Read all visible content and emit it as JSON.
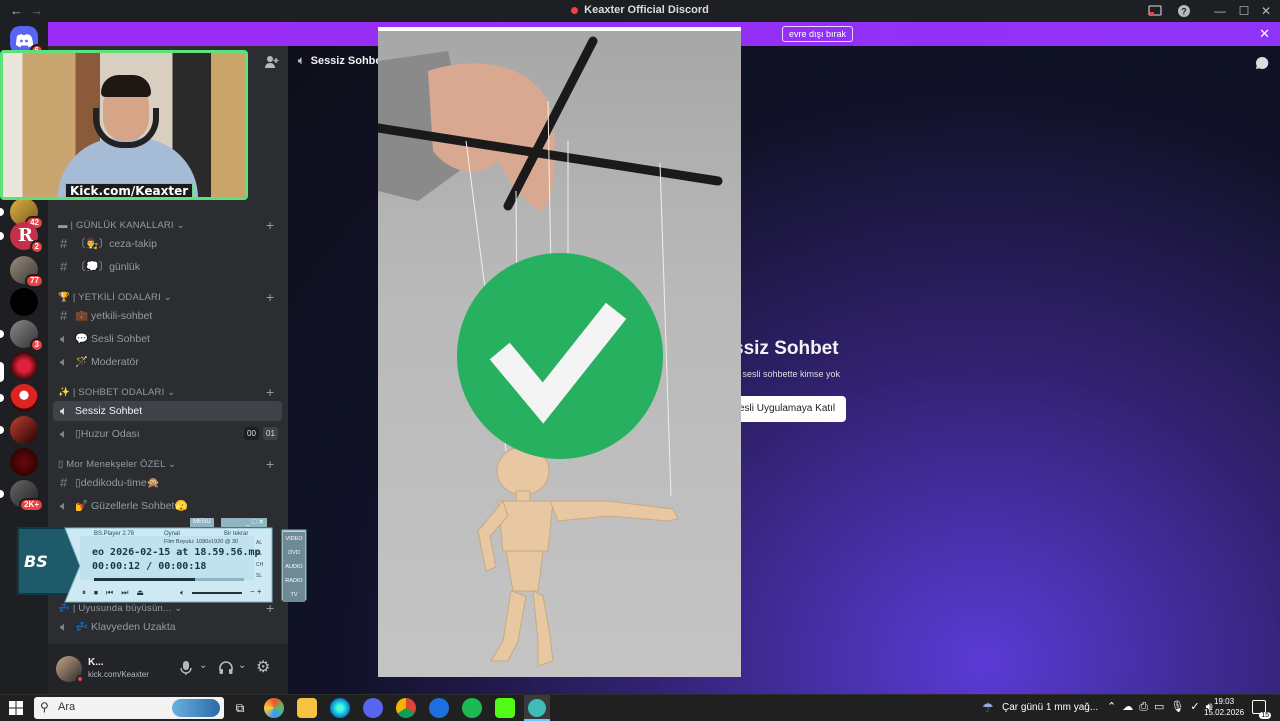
{
  "titlebar": {
    "title": "Keaxter Official Discord",
    "back": "←",
    "forward": "→"
  },
  "notice": {
    "button_label": "evre dışı bırak",
    "close": "✕"
  },
  "rail": {
    "servers": [
      {
        "badge": "6"
      },
      {
        "badge": "42"
      },
      {
        "badge": "2"
      },
      {
        "badge": "77"
      },
      {
        "badge": ""
      },
      {
        "badge": "3"
      },
      {
        "badge": ""
      },
      {
        "badge": ""
      },
      {
        "badge": ""
      },
      {
        "badge": ""
      },
      {
        "badge": "2K+"
      }
    ]
  },
  "sidebar": {
    "server_name": "Keaxter Official",
    "categories": [
      {
        "label": "▬ | GÜNLÜK KANALLARI ⌄"
      },
      {
        "label": "🏆 | YETKİLİ ODALARI ⌄"
      },
      {
        "label": "✨ | SOHBET ODALARI ⌄"
      },
      {
        "label": "▯ Mor Menekşeler ÖZEL ⌄"
      },
      {
        "label": "💤 | Uyusunda büyüsün... ⌄"
      }
    ],
    "channels": [
      {
        "label": "〔👨‍⚖️〕ceza-takip"
      },
      {
        "label": "〔💭〕günlük"
      },
      {
        "label": "💼 yetkili-sohbet"
      },
      {
        "label": "💬 Sesli Sohbet"
      },
      {
        "label": "🪄 Moderatör"
      },
      {
        "label": "Sessiz Sohbet"
      },
      {
        "label": "▯Huzur Odası",
        "count_a": "00",
        "count_b": "01"
      },
      {
        "label": "▯dedikodu-time🙊"
      },
      {
        "label": "💅 Güzellerle Sohbet🫣"
      },
      {
        "label": "💤 Klavyeden Uzakta"
      }
    ],
    "user": {
      "name": "K...",
      "status": "kick.com/Keaxter"
    }
  },
  "webcam": {
    "tag": "Kick.com/Keaxter"
  },
  "main": {
    "header_channel": "Sessiz Sohbet",
    "title": "ssiz Sohbet",
    "subtitle": "n sesli sohbette kimse yok",
    "join_label": "esli Uygulamaya Katıl"
  },
  "bsplayer": {
    "logo": "BS",
    "menu": "MENU",
    "version": "BS.Player 2.78",
    "state": "Oynat",
    "repeat": "Bir tekrar",
    "filesize": "Film Boyutu: 1080x1920 @ 30",
    "filename": "eo 2026-02-15 at 18.59.56.mp",
    "time": "00:00:12 / 00:00:18",
    "side_buttons": [
      "VIDEO",
      "DVD",
      "AUDIO",
      "RADIO",
      "TV"
    ],
    "side_small": [
      "AL",
      "PL",
      "CH",
      "SL"
    ],
    "progress": 0.67
  },
  "taskbar": {
    "search_label": "Ara",
    "weather": "Çar günü 1 mm yağ...",
    "time": "19:03",
    "date": "15.02.2026",
    "notif_count": "15"
  }
}
